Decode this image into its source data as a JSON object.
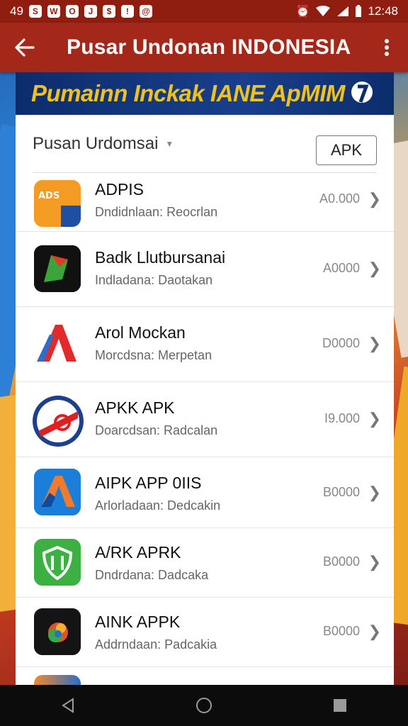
{
  "status_bar": {
    "time_left": "49",
    "notifications": [
      "S",
      "W",
      "O",
      "J",
      "$",
      "!",
      "@"
    ],
    "time": "12:48"
  },
  "appbar": {
    "back_icon": "arrow-left-icon",
    "title": "Pusar Undonan INDONESIA",
    "menu_icon": "more-vert-icon"
  },
  "banner": {
    "text": "Pumainn Inckak IANE ApMIM"
  },
  "filter": {
    "label": "Pusan Urdomsai",
    "button": "APK"
  },
  "apps": [
    {
      "name": "ADPIS",
      "sub": "Dndidnlaan: Reocrlan",
      "value": "A0.000",
      "icon": "orange-badge-icon"
    },
    {
      "name": "Badk Llutbursanai",
      "sub": "Indladana: Daotakan",
      "value": "A0000",
      "icon": "green-leaf-icon"
    },
    {
      "name": "Arol Mockan",
      "sub": "Morcdsna: Merpetan",
      "value": "D0000",
      "icon": "red-a-icon"
    },
    {
      "name": "APKK APK",
      "sub": "Doarcdsan: Radcalan",
      "value": "I9.000",
      "icon": "round-seal-icon"
    },
    {
      "name": "AIPK APP 0IIS",
      "sub": "Arlorladaan: Dedcakin",
      "value": "B0000",
      "icon": "blue-a-icon"
    },
    {
      "name": "A/RK APRK",
      "sub": "Dndrdana: Dadcaka",
      "value": "B0000",
      "icon": "green-shield-icon"
    },
    {
      "name": "AINK APPK",
      "sub": "Addrndaan: Padcakia",
      "value": "B0000",
      "icon": "colorful-bird-icon"
    }
  ],
  "nav": {
    "back": "nav-back-icon",
    "home": "nav-home-icon",
    "recents": "nav-recents-icon"
  }
}
